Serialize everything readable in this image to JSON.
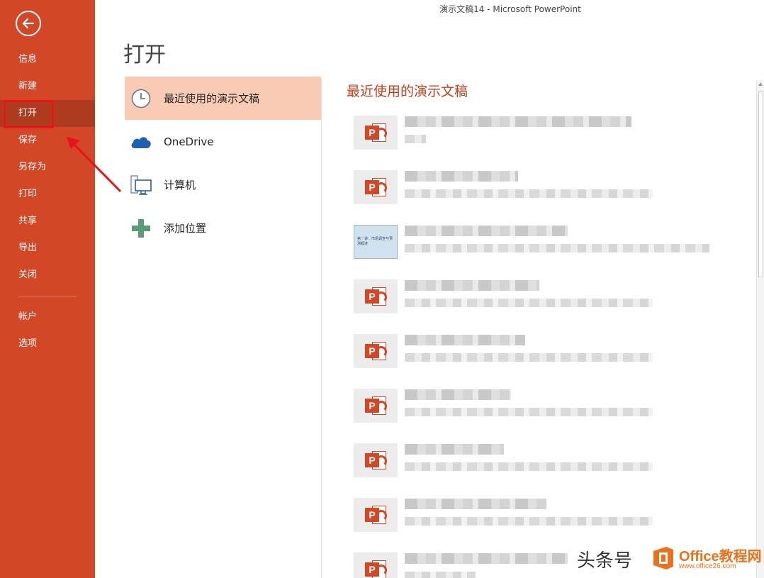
{
  "window": {
    "title": "演示文稿14 - Microsoft PowerPoint"
  },
  "colors": {
    "accent": "#d24726",
    "sidebar_active": "#ae3a1f",
    "location_active": "#f9cbb4",
    "highlight": "#e81418",
    "recent_title": "#c43e1c"
  },
  "sidebar": {
    "back_icon": "back-arrow-icon",
    "items": [
      {
        "label": "信息"
      },
      {
        "label": "新建"
      },
      {
        "label": "打开",
        "active": true
      },
      {
        "label": "保存"
      },
      {
        "label": "另存为"
      },
      {
        "label": "打印"
      },
      {
        "label": "共享"
      },
      {
        "label": "导出"
      },
      {
        "label": "关闭"
      }
    ],
    "bottom_items": [
      {
        "label": "帐户"
      },
      {
        "label": "选项"
      }
    ]
  },
  "main": {
    "title": "打开",
    "locations": [
      {
        "label": "最近使用的演示文稿",
        "icon": "clock-icon",
        "active": true
      },
      {
        "label": "OneDrive",
        "icon": "cloud-icon"
      },
      {
        "label": "计算机",
        "icon": "computer-icon"
      },
      {
        "label": "添加位置",
        "icon": "plus-icon"
      }
    ],
    "recent_title": "最近使用的演示文稿",
    "recent_files": [
      {
        "thumb": "ppt-file-icon"
      },
      {
        "thumb": "ppt-file-icon"
      },
      {
        "thumb": "slide-thumbnail",
        "thumb_text": "第一讲：市场调查与预测概述"
      },
      {
        "thumb": "ppt-file-icon"
      },
      {
        "thumb": "ppt-file-icon"
      },
      {
        "thumb": "ppt-file-icon"
      },
      {
        "thumb": "ppt-file-icon"
      },
      {
        "thumb": "ppt-file-icon"
      },
      {
        "thumb": "ppt-file-icon"
      }
    ]
  },
  "watermark": {
    "left_text": "头条号",
    "brand": "Office教程网",
    "url": "www.office26.com"
  }
}
